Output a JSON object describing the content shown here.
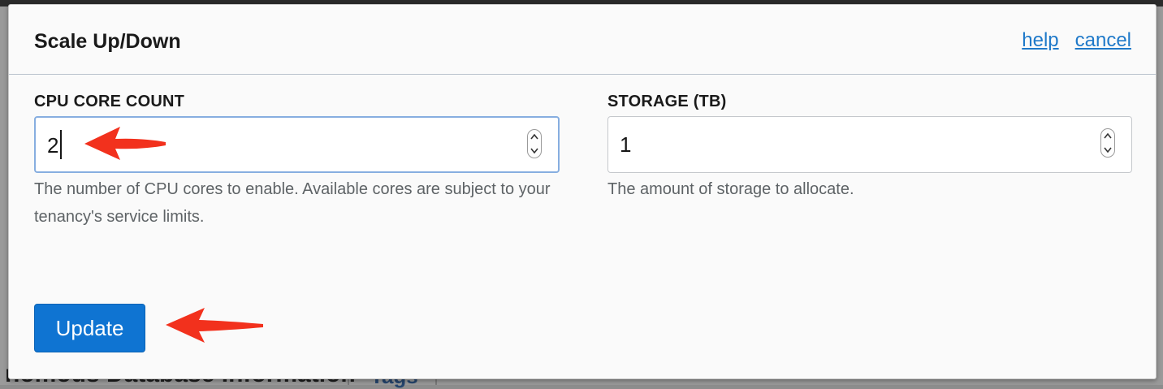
{
  "modal": {
    "title": "Scale Up/Down",
    "links": {
      "help": "help",
      "cancel": "cancel"
    }
  },
  "cpu": {
    "label": "CPU CORE COUNT",
    "value": "2",
    "help": "The number of CPU cores to enable. Available cores are subject to your tenancy's service limits."
  },
  "storage": {
    "label": "STORAGE (TB)",
    "value": "1",
    "help": "The amount of storage to allocate."
  },
  "actions": {
    "update_label": "Update"
  },
  "background": {
    "heading_fragment": "nomous Database Information",
    "tab_fragment": "Tags"
  },
  "colors": {
    "primary": "#0f74d2",
    "link": "#1f79c9",
    "focus_border": "#87aee0",
    "annotation_arrow": "#f2311d"
  },
  "icons": {
    "spinner": "up-down-spinner-icon",
    "annotation": "red-arrow-icon"
  }
}
